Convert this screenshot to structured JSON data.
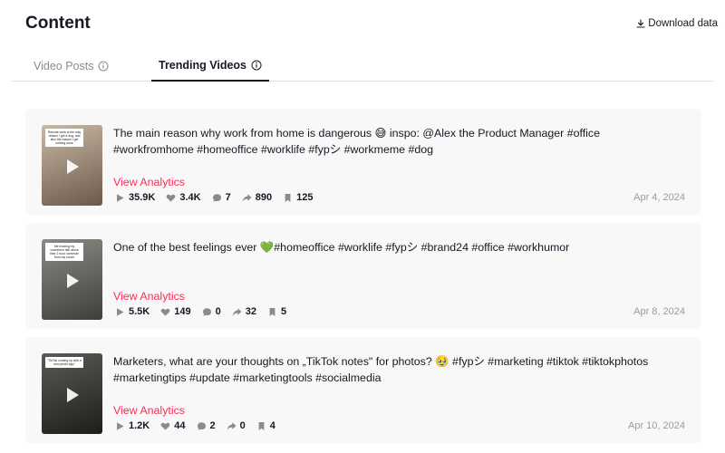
{
  "header": {
    "title": "Content",
    "download_label": "Download data"
  },
  "tabs": [
    {
      "label": "Video Posts",
      "active": false
    },
    {
      "label": "Trending Videos",
      "active": true
    }
  ],
  "videos": [
    {
      "caption": "The main reason why work from home is dangerous 😅 inspo: @Alex the Product Manager #office #workfromhome #homeoffice #worklife #fypシ #workmeme #dog",
      "analytics_label": "View Analytics",
      "views": "35.9K",
      "likes": "3.4K",
      "comments": "7",
      "shares": "890",
      "saves": "125",
      "date": "Apr 4, 2024",
      "thumb_text": "Remote work is the only reason I got a dog, and also the reason I get nothing done",
      "thumb_colors": [
        "#c9b8a4",
        "#6b5a4c"
      ]
    },
    {
      "caption": "One of the best feelings ever 💚#homeoffice #worklife #fypシ #brand24 #office #workhumor",
      "analytics_label": "View Analytics",
      "views": "5.5K",
      "likes": "149",
      "comments": "0",
      "shares": "32",
      "saves": "5",
      "date": "Apr 8, 2024",
      "thumb_text": "Me hearing my coworkers talk about their 2 hour commute from my couch",
      "thumb_colors": [
        "#8b8b86",
        "#3f3e3b"
      ]
    },
    {
      "caption": "Marketers, what are your thoughts on „TikTok notes\" for photos? 🥹 #fypシ #marketing #tiktok #tiktokphotos #marketingtips #update #marketingtools #socialmedia",
      "analytics_label": "View Analytics",
      "views": "1.2K",
      "likes": "44",
      "comments": "2",
      "shares": "0",
      "saves": "4",
      "date": "Apr 10, 2024",
      "thumb_text": "\"TikTok coming up with a new photo app\"",
      "thumb_colors": [
        "#5c5a56",
        "#1e1d1b"
      ]
    }
  ],
  "icons": {
    "download": "download-icon",
    "info": "info-icon",
    "views": "play-icon",
    "likes": "heart-icon",
    "comments": "comment-icon",
    "shares": "share-icon",
    "saves": "bookmark-icon"
  },
  "colors": {
    "accent": "#fe2c55",
    "text": "#161823",
    "muted": "#8a8b91",
    "card_bg": "#f8f8f8"
  }
}
